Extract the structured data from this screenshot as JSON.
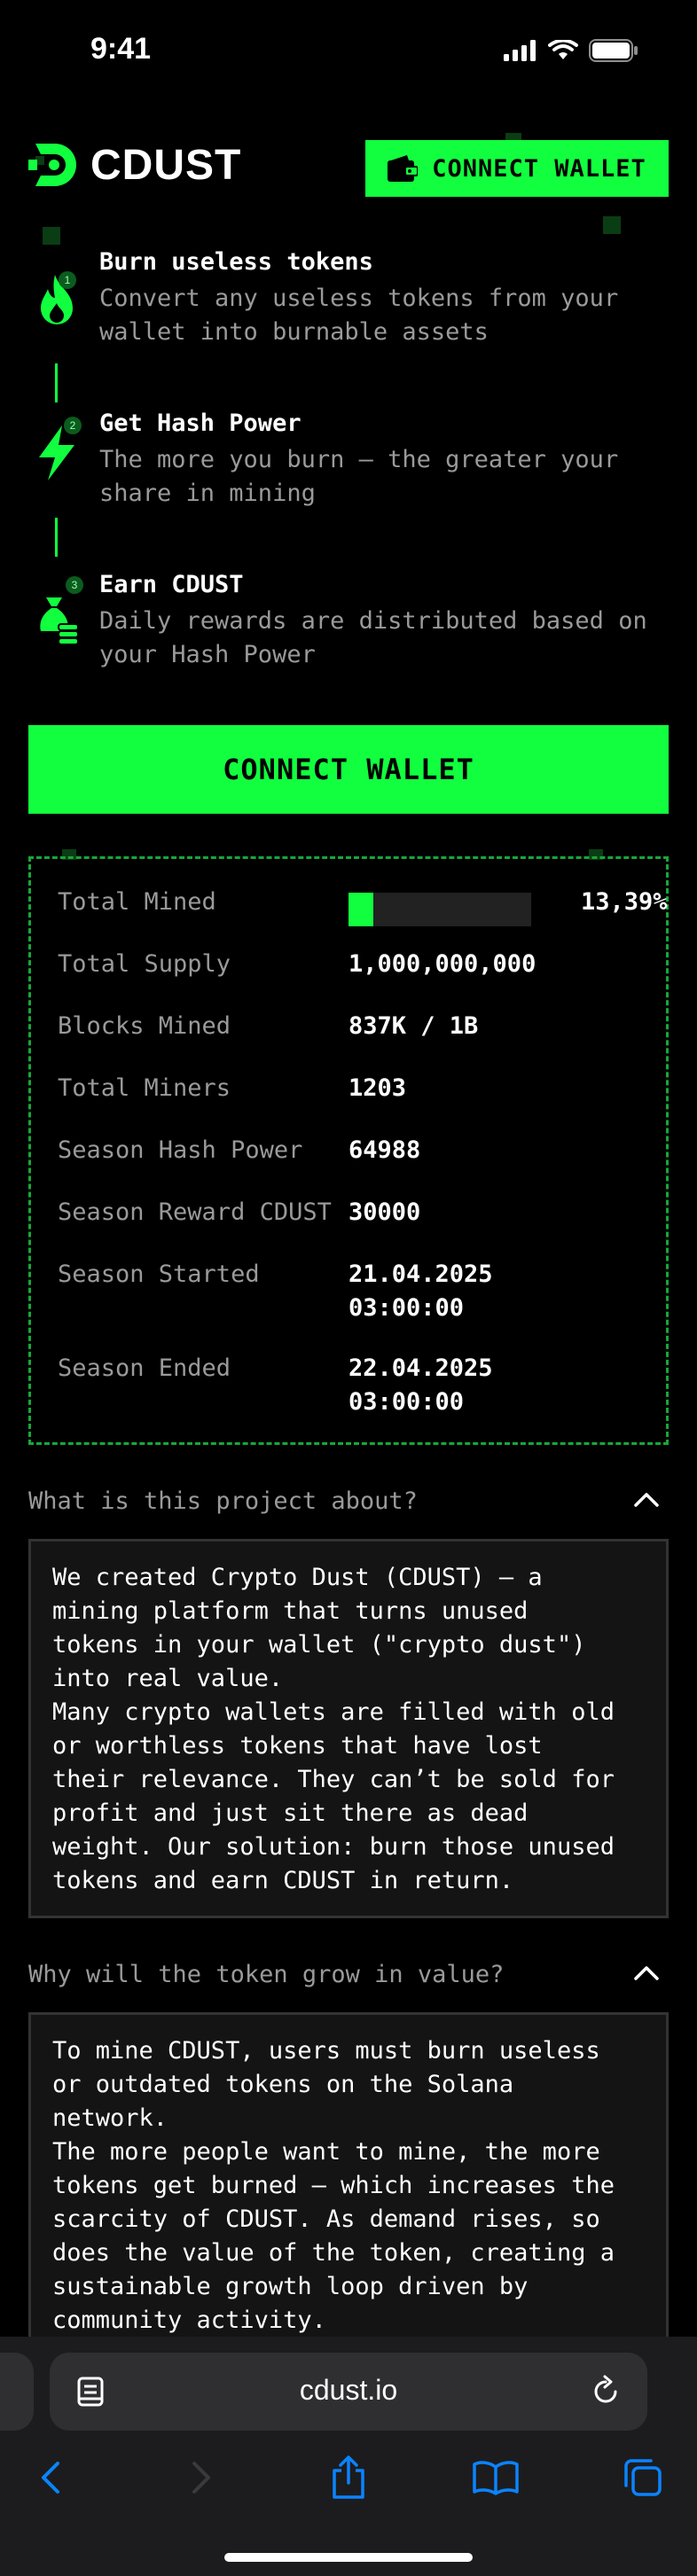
{
  "status_bar": {
    "time": "9:41"
  },
  "header": {
    "logo_text": "CDUST",
    "connect_label": "CONNECT WALLET",
    "icons": {
      "logo": "cdust-logo-icon",
      "wallet": "wallet-icon"
    }
  },
  "steps": [
    {
      "number": "1",
      "icon": "fire-icon",
      "title": "Burn useless tokens",
      "description": "Convert any useless tokens from your wallet into burnable assets"
    },
    {
      "number": "2",
      "icon": "lightning-icon",
      "title": "Get Hash Power",
      "description": "The more you burn — the greater your share in mining"
    },
    {
      "number": "3",
      "icon": "money-bag-icon",
      "title": "Earn CDUST",
      "description": "Daily rewards are distributed based on your Hash Power"
    }
  ],
  "main_cta": {
    "label": "CONNECT WALLET"
  },
  "stats": {
    "total_mined": {
      "label": "Total Mined",
      "value": "13,39%",
      "progress": 0.1339
    },
    "rows": [
      {
        "label": "Total Supply",
        "value": "1,000,000,000"
      },
      {
        "label": "Blocks Mined",
        "value": "837K / 1B"
      },
      {
        "label": "Total Miners",
        "value": "1203"
      },
      {
        "label": "Season Hash Power",
        "value": "64988"
      },
      {
        "label": "Season Reward CDUST",
        "value": "30000"
      },
      {
        "label": "Season Started",
        "value": "21.04.2025\n03:00:00"
      },
      {
        "label": "Season Ended",
        "value": "22.04.2025\n03:00:00"
      }
    ]
  },
  "faq": [
    {
      "question": "What is this project about?",
      "answer": "We created Crypto Dust (CDUST) — a\nmining platform that turns unused\ntokens in your wallet (\"crypto dust\")\ninto real value.\nMany crypto wallets are filled with old\nor worthless tokens that have lost\ntheir relevance. They can’t be sold for\nprofit and just sit there as dead\nweight. Our solution: burn those unused\ntokens and earn CDUST in return."
    },
    {
      "question": "Why will the token grow in value?",
      "answer": "To mine CDUST, users must burn useless\nor outdated tokens on the Solana\nnetwork.\nThe more people want to mine, the more\ntokens get burned — which increases the\nscarcity of CDUST. As demand rises, so\ndoes the value of the token, creating a\nsustainable growth loop driven by\ncommunity activity."
    }
  ],
  "browser": {
    "url": "cdust.io",
    "toolbar": [
      "back-icon",
      "forward-icon",
      "share-icon",
      "bookmarks-icon",
      "tabs-icon"
    ]
  },
  "colors": {
    "accent": "#12ff3f",
    "background": "#000000",
    "muted_text": "#9a9a9a",
    "dashed_border": "#16a837"
  }
}
